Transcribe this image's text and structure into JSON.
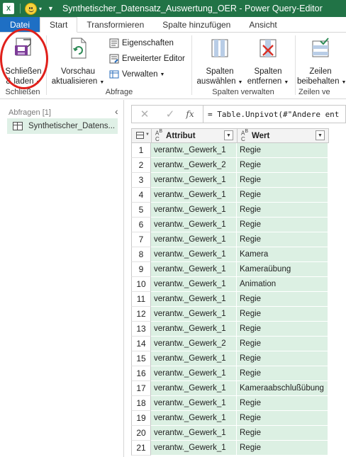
{
  "titlebar": {
    "app_icon": "excel-logo",
    "title": "Synthetischer_Datensatz_Auswertung_OER - Power Query-Editor"
  },
  "tabs": [
    {
      "label": "Datei"
    },
    {
      "label": "Start"
    },
    {
      "label": "Transformieren"
    },
    {
      "label": "Spalte hinzufügen"
    },
    {
      "label": "Ansicht"
    }
  ],
  "ribbon": {
    "close_group": {
      "label": "Schließen",
      "close_load": {
        "line1": "Schließen",
        "line2": "& laden",
        "icon": "close-load-icon"
      }
    },
    "query_group": {
      "label": "Abfrage",
      "preview": {
        "line1": "Vorschau",
        "line2": "aktualisieren",
        "icon": "refresh-preview-icon"
      },
      "properties": "Eigenschaften",
      "advanced_editor": "Erweiterter Editor",
      "manage": "Verwalten"
    },
    "columns_group": {
      "label": "Spalten verwalten",
      "choose": {
        "line1": "Spalten",
        "line2": "auswählen"
      },
      "remove": {
        "line1": "Spalten",
        "line2": "entfernen"
      }
    },
    "rows_group": {
      "label": "Zeilen ve",
      "keep": {
        "line1": "Zeilen",
        "line2": "beibehalten"
      }
    }
  },
  "queries": {
    "header": "Abfragen [1]",
    "items": [
      {
        "label": "Synthetischer_Datens..."
      }
    ]
  },
  "formula_bar": {
    "formula": "= Table.Unpivot(#\"Andere ent"
  },
  "table": {
    "columns": [
      {
        "name": "Attribut",
        "type_icon": "ABC"
      },
      {
        "name": "Wert",
        "type_icon": "ABC"
      }
    ],
    "rows": [
      {
        "idx": "1",
        "a": "verantw._Gewerk_1",
        "w": "Regie"
      },
      {
        "idx": "2",
        "a": "verantw._Gewerk_2",
        "w": "Regie"
      },
      {
        "idx": "3",
        "a": "verantw._Gewerk_1",
        "w": "Regie"
      },
      {
        "idx": "4",
        "a": "verantw._Gewerk_1",
        "w": "Regie"
      },
      {
        "idx": "5",
        "a": "verantw._Gewerk_1",
        "w": "Regie"
      },
      {
        "idx": "6",
        "a": "verantw._Gewerk_1",
        "w": "Regie"
      },
      {
        "idx": "7",
        "a": "verantw._Gewerk_1",
        "w": "Regie"
      },
      {
        "idx": "8",
        "a": "verantw._Gewerk_1",
        "w": "Kamera"
      },
      {
        "idx": "9",
        "a": "verantw._Gewerk_1",
        "w": "Kameraübung"
      },
      {
        "idx": "10",
        "a": "verantw._Gewerk_1",
        "w": "Animation"
      },
      {
        "idx": "11",
        "a": "verantw._Gewerk_1",
        "w": "Regie"
      },
      {
        "idx": "12",
        "a": "verantw._Gewerk_1",
        "w": "Regie"
      },
      {
        "idx": "13",
        "a": "verantw._Gewerk_1",
        "w": "Regie"
      },
      {
        "idx": "14",
        "a": "verantw._Gewerk_2",
        "w": "Regie"
      },
      {
        "idx": "15",
        "a": "verantw._Gewerk_1",
        "w": "Regie"
      },
      {
        "idx": "16",
        "a": "verantw._Gewerk_1",
        "w": "Regie"
      },
      {
        "idx": "17",
        "a": "verantw._Gewerk_1",
        "w": "Kameraabschlußübung"
      },
      {
        "idx": "18",
        "a": "verantw._Gewerk_1",
        "w": "Regie"
      },
      {
        "idx": "19",
        "a": "verantw._Gewerk_1",
        "w": "Regie"
      },
      {
        "idx": "20",
        "a": "verantw._Gewerk_1",
        "w": "Regie"
      },
      {
        "idx": "21",
        "a": "verantw._Gewerk_1",
        "w": "Regie"
      }
    ]
  },
  "colors": {
    "excel_green": "#217346",
    "file_tab_blue": "#1e6fc4",
    "cell_green": "#dcf0e3",
    "highlight_red": "#e0201b"
  }
}
